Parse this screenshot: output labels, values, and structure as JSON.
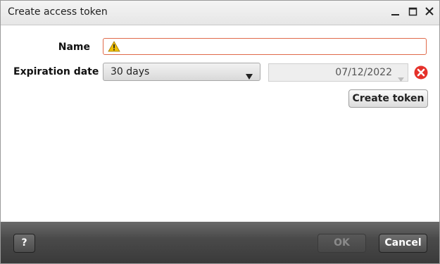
{
  "window": {
    "title": "Create access token"
  },
  "form": {
    "name_label": "Name",
    "name_value": "",
    "expiration_label": "Expiration date",
    "expiration_selected": "30 days",
    "expiration_date": "07/12/2022",
    "create_token_label": "Create token"
  },
  "footer": {
    "help_label": "?",
    "ok_label": "OK",
    "cancel_label": "Cancel"
  },
  "colors": {
    "error_border": "#e06a4a",
    "warning_yellow": "#f0c000",
    "error_red": "#e5322b",
    "footer_bg": "#4a4a4a"
  },
  "icons": {
    "warning": "warning-triangle-icon",
    "error": "error-circle-x-icon",
    "minimize": "minimize-icon",
    "maximize": "maximize-icon",
    "close": "close-icon",
    "dropdown": "chevron-down-icon"
  }
}
